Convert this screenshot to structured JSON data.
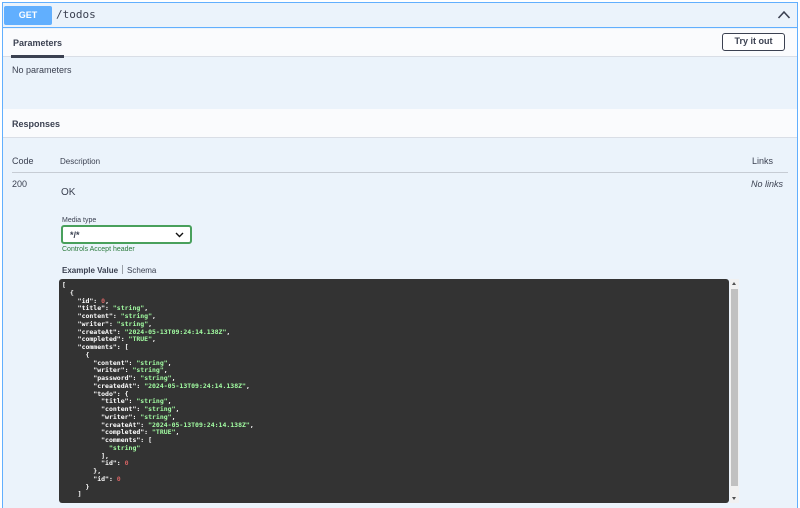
{
  "operation": {
    "method": "GET",
    "path": "/todos"
  },
  "parameters": {
    "tab_label": "Parameters",
    "try_button": "Try it out",
    "empty_text": "No parameters"
  },
  "responses": {
    "title": "Responses",
    "columns": {
      "code": "Code",
      "description": "Description",
      "links": "Links"
    },
    "row": {
      "code": "200",
      "description": "OK",
      "links": "No links",
      "media_type_label": "Media type",
      "media_type_value": "*/*",
      "accept_note": "Controls Accept header",
      "example_tab": "Example Value",
      "schema_tab": "Schema"
    }
  },
  "example_json_lines": [
    "[",
    "  {",
    "    \"id\": 0,",
    "    \"title\": \"string\",",
    "    \"content\": \"string\",",
    "    \"writer\": \"string\",",
    "    \"createAt\": \"2024-05-13T09:24:14.138Z\",",
    "    \"completed\": \"TRUE\",",
    "    \"comments\": [",
    "      {",
    "        \"content\": \"string\",",
    "        \"writer\": \"string\",",
    "        \"password\": \"string\",",
    "        \"createdAt\": \"2024-05-13T09:24:14.138Z\",",
    "        \"todo\": {",
    "          \"title\": \"string\",",
    "          \"content\": \"string\",",
    "          \"writer\": \"string\",",
    "          \"createAt\": \"2024-05-13T09:24:14.138Z\",",
    "          \"completed\": \"TRUE\",",
    "          \"comments\": [",
    "            \"string\"",
    "          ],",
    "          \"id\": 0",
    "        },",
    "        \"id\": 0",
    "      }",
    "    ]"
  ],
  "colors": {
    "accent": "#61affe",
    "panel": "#ebf3fb",
    "select_border": "#49a05c",
    "code_bg": "#333333",
    "json_string": "#a2fca2",
    "json_number": "#d36363"
  }
}
